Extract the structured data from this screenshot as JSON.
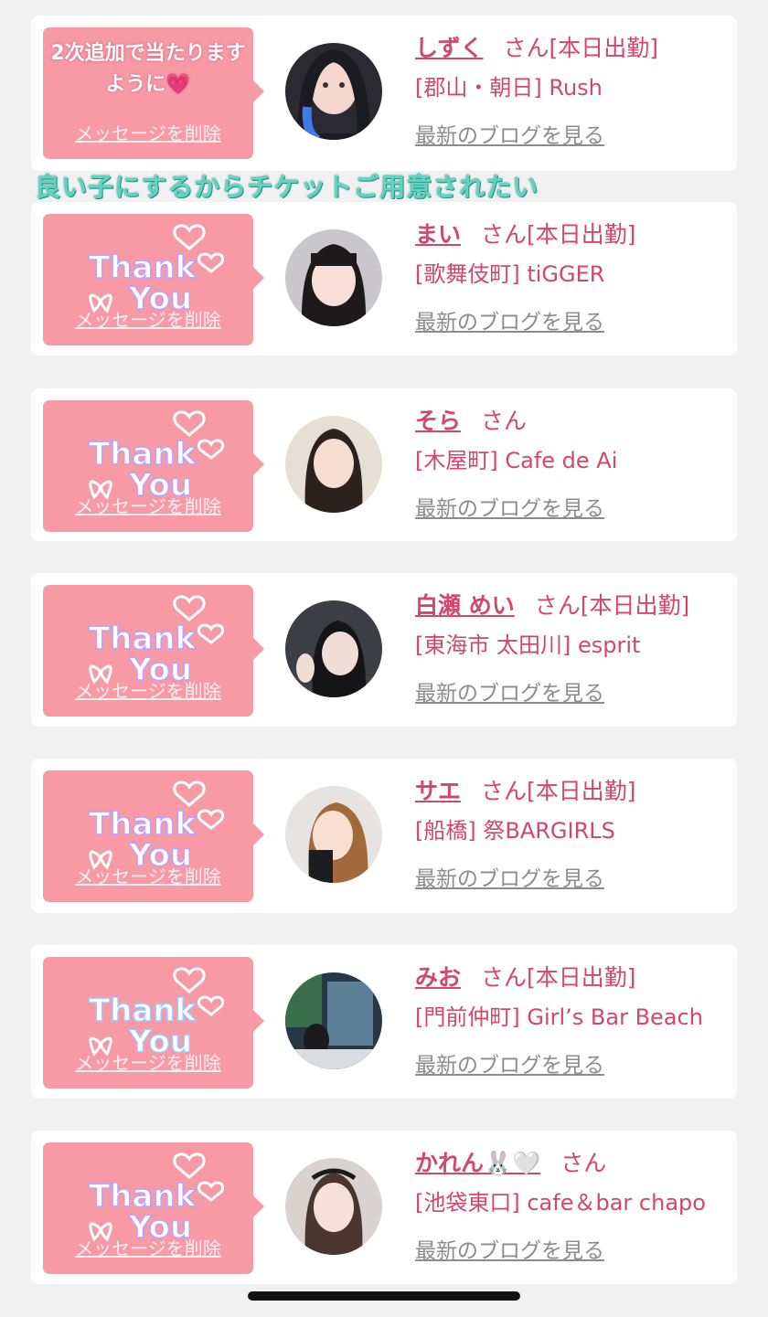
{
  "overlay_caption": "良い子にするからチケットご用意されたい",
  "first_bubble_message": "2次追加で当たりますように💗",
  "delete_label": "メッセージを削除",
  "blog_label": "最新のブログを見る",
  "san_label": "さん",
  "entries": [
    {
      "name": "しずく",
      "status": "[本日出勤]",
      "shop": "[郡山・朝日] Rush"
    },
    {
      "name": "まい",
      "status": "[本日出勤]",
      "shop": "[歌舞伎町] tiGGER"
    },
    {
      "name": "そら",
      "status": "",
      "shop": "[木屋町] Cafe de Ai"
    },
    {
      "name": "白瀬 めい",
      "status": "[本日出勤]",
      "shop": "[東海市 太田川] esprit"
    },
    {
      "name": "サエ",
      "status": "[本日出勤]",
      "shop": "[船橋] 祭BARGIRLS"
    },
    {
      "name": "みお",
      "status": "[本日出勤]",
      "shop": "[門前仲町] Girl’s Bar Beach"
    },
    {
      "name": "かれん🐰🤍",
      "status": "",
      "shop": "[池袋東口] cafe＆bar chapo"
    }
  ],
  "sticker_text": [
    "Thank",
    "You"
  ],
  "colors": {
    "accent": "#d2476c",
    "bubble": "#f89aa6",
    "caption": "#61d3c3"
  }
}
